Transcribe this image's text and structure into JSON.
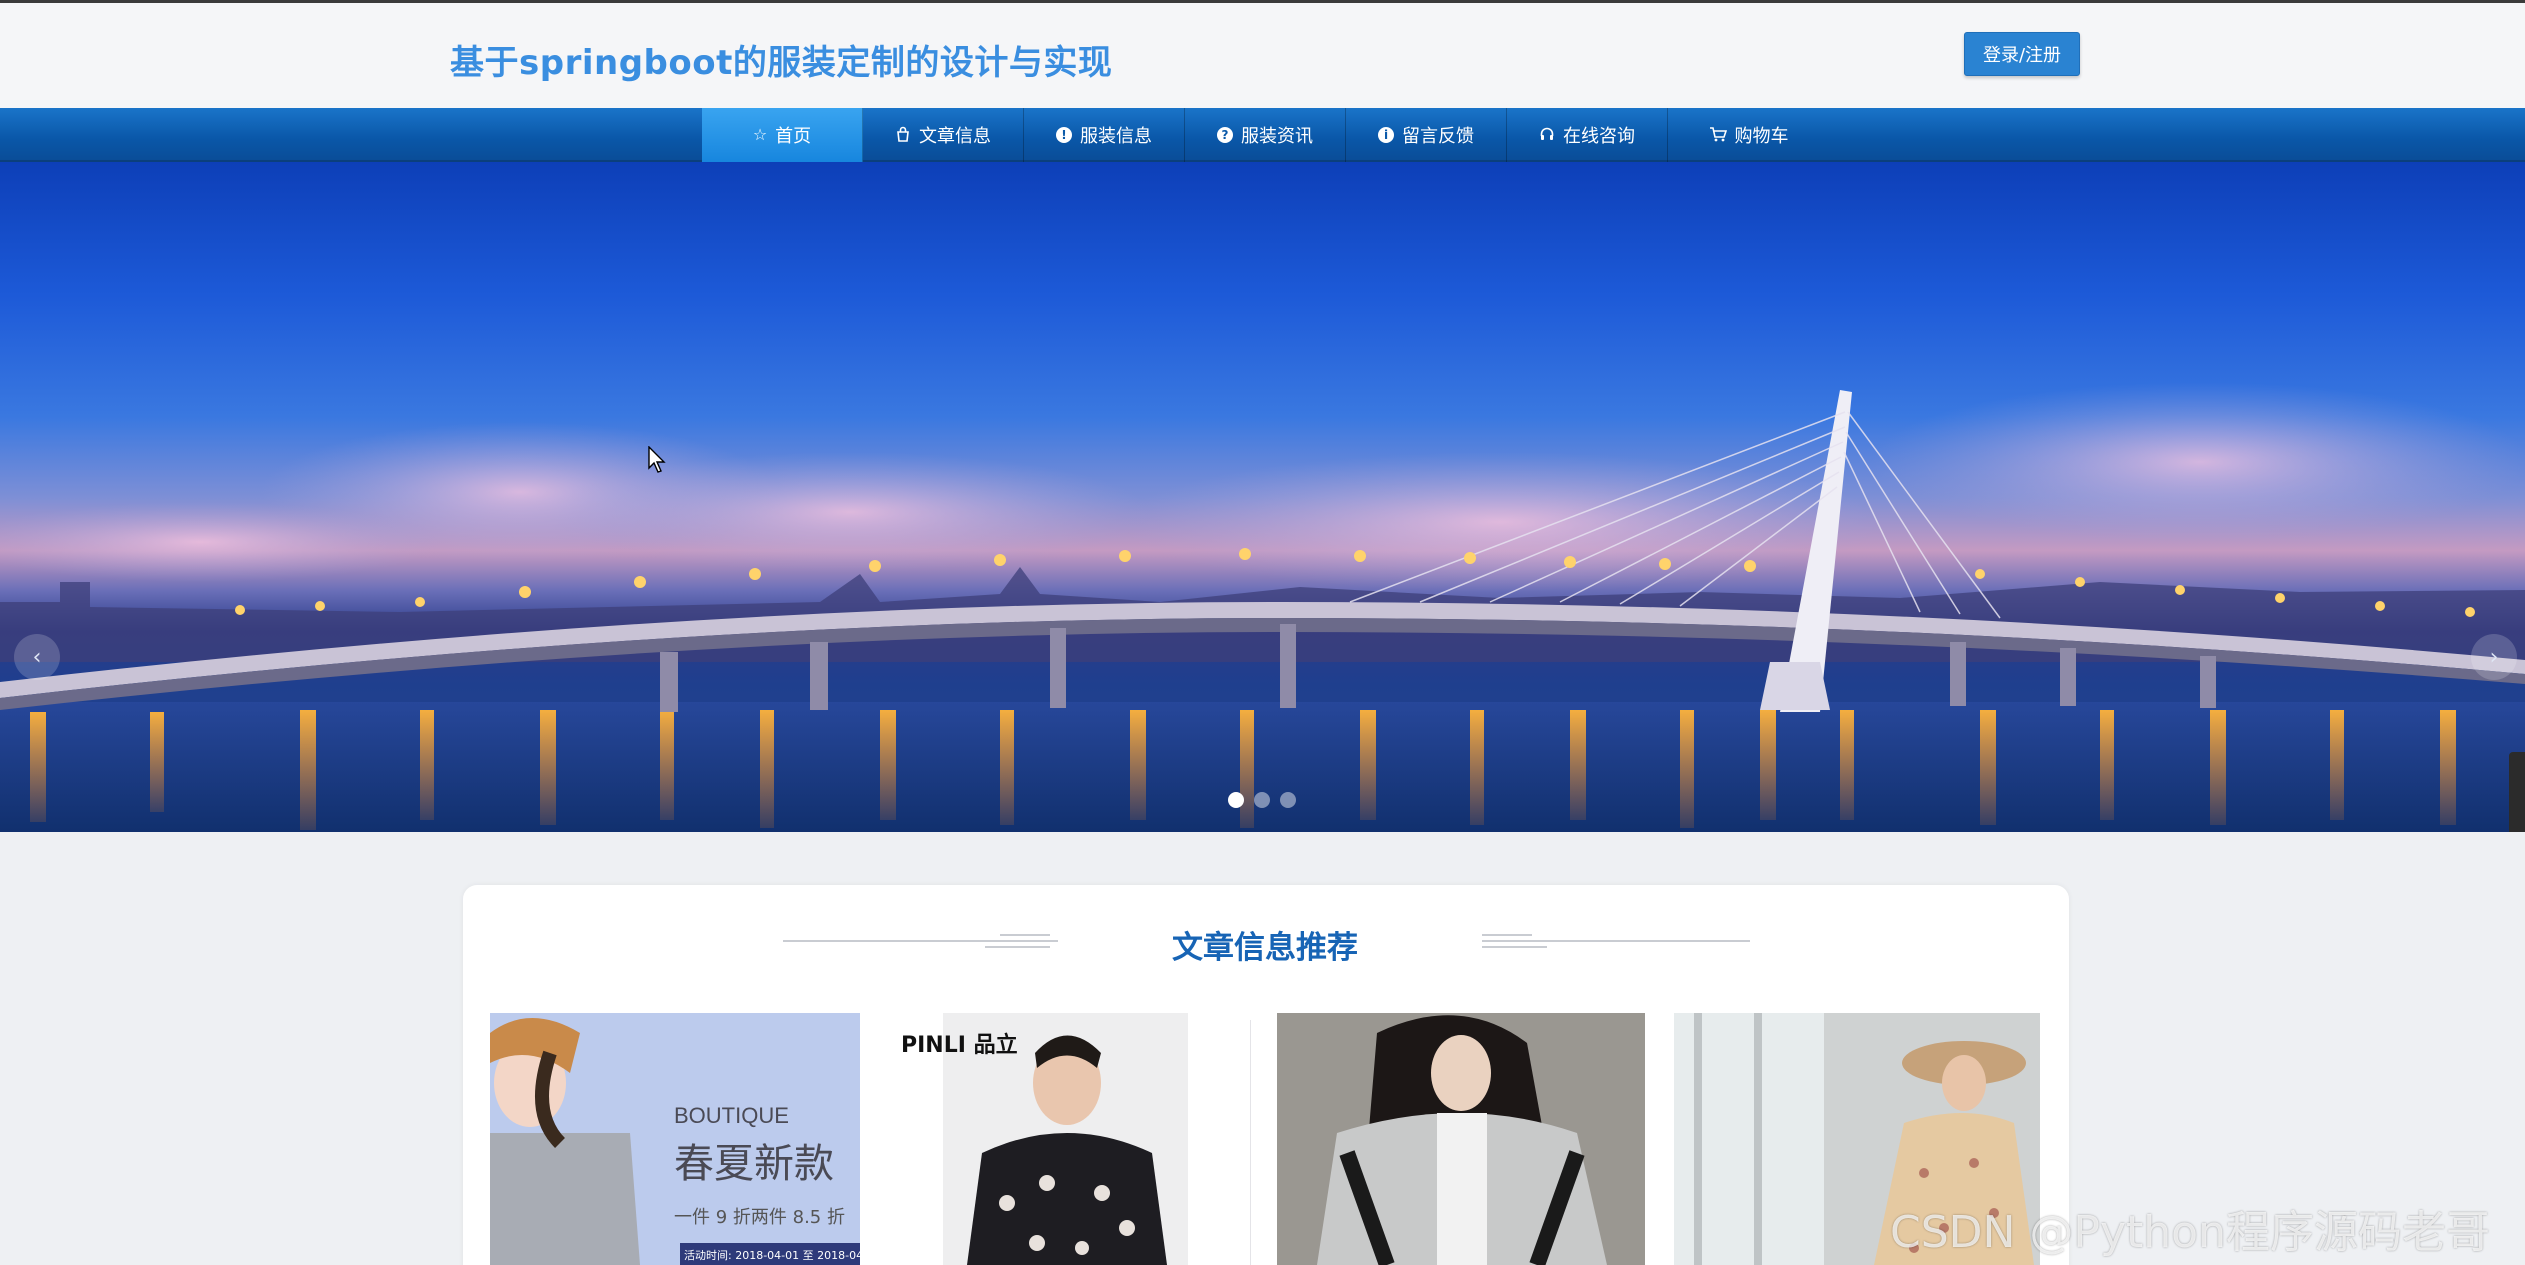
{
  "header": {
    "title": "基于springboot的服装定制的设计与实现",
    "login_label": "登录/注册"
  },
  "nav": {
    "items": [
      {
        "label": "首页",
        "icon": "star-icon"
      },
      {
        "label": "文章信息",
        "icon": "bag-icon"
      },
      {
        "label": "服装信息",
        "icon": "info-icon"
      },
      {
        "label": "服装资讯",
        "icon": "question-icon"
      },
      {
        "label": "留言反馈",
        "icon": "info-icon"
      },
      {
        "label": "在线咨询",
        "icon": "headset-icon"
      },
      {
        "label": "购物车",
        "icon": "cart-icon"
      }
    ],
    "active_index": 0
  },
  "banner": {
    "prev_label": "‹",
    "next_label": "›",
    "slide_count": 3,
    "active_slide": 0
  },
  "section": {
    "title": "文章信息推荐"
  },
  "cards": [
    {
      "brand": "BOUTIQUE",
      "headline": "春夏新款",
      "promo": "一件 9 折两件 8.5 折",
      "date": "活动时间: 2018-04-01 至 2018-04"
    },
    {
      "brand": "PINLI 品立"
    },
    {},
    {}
  ],
  "watermark": "CSDN @Python程序源码老哥",
  "colors": {
    "title": "#3a8ee0",
    "nav": "#0a57a8",
    "nav_active": "#1786de",
    "section_title": "#1764b5"
  }
}
